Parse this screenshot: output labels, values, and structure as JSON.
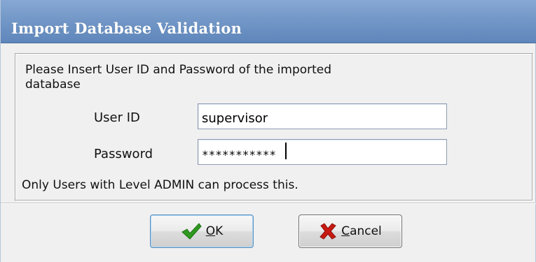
{
  "window": {
    "title": "Import Database Validation"
  },
  "form": {
    "prompt": "Please Insert User ID and Password of the imported database",
    "user_id_label": "User ID",
    "user_id_value": "supervisor",
    "password_label": "Password",
    "password_value": "***********",
    "note": "Only Users with Level ADMIN can process this."
  },
  "buttons": {
    "ok": {
      "accel": "O",
      "rest": "K",
      "icon": "checkmark-icon",
      "icon_color": "#2e9a1e"
    },
    "cancel": {
      "accel": "C",
      "rest": "ancel",
      "icon": "x-icon",
      "icon_color": "#c81a12"
    }
  },
  "colors": {
    "titlebar": "#7398c8",
    "background": "#f0f0f0"
  }
}
